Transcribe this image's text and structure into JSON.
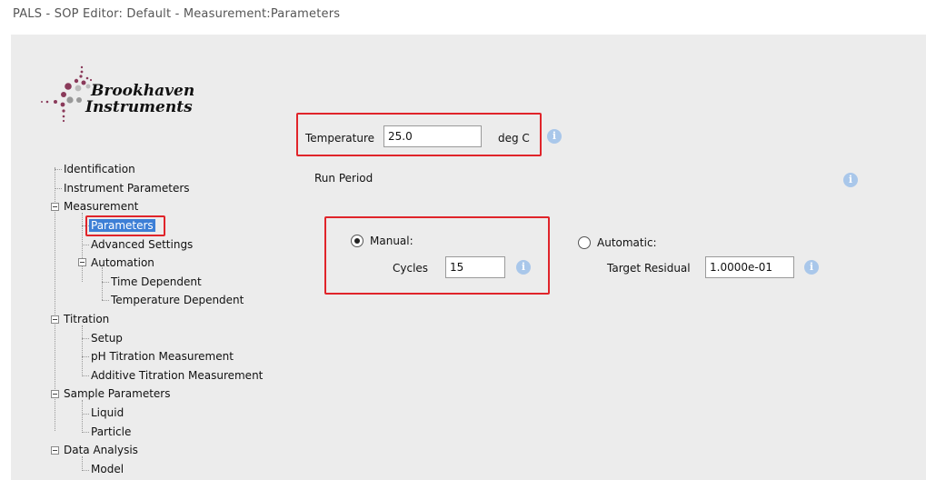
{
  "window": {
    "title": "PALS - SOP Editor: Default - Measurement:Parameters"
  },
  "logo": {
    "line1": "Brookhaven",
    "line2": "Instruments",
    "icon": "dots-logo-icon"
  },
  "tree": {
    "items": [
      {
        "label": "Identification"
      },
      {
        "label": "Instrument Parameters"
      },
      {
        "label": "Measurement"
      },
      {
        "label": "Parameters",
        "selected": true
      },
      {
        "label": "Advanced Settings"
      },
      {
        "label": "Automation"
      },
      {
        "label": "Time Dependent"
      },
      {
        "label": "Temperature Dependent"
      },
      {
        "label": "Titration"
      },
      {
        "label": "Setup"
      },
      {
        "label": "pH Titration Measurement"
      },
      {
        "label": "Additive Titration Measurement"
      },
      {
        "label": "Sample Parameters"
      },
      {
        "label": "Liquid"
      },
      {
        "label": "Particle"
      },
      {
        "label": "Data Analysis"
      },
      {
        "label": "Model"
      }
    ]
  },
  "form": {
    "temperature": {
      "label": "Temperature",
      "value": "25.0",
      "unit": "deg C"
    },
    "run_period": {
      "label": "Run Period"
    },
    "manual": {
      "label": "Manual:",
      "selected": true,
      "cycles_label": "Cycles",
      "cycles_value": "15"
    },
    "automatic": {
      "label": "Automatic:",
      "selected": false,
      "residual_label": "Target Residual",
      "residual_value": "1.0000e-01"
    },
    "info_glyph": "i"
  },
  "colors": {
    "highlight_box": "#e0242a",
    "selection": "#3d7fd6",
    "panel": "#ececec",
    "info_icon": "#a9c7ea"
  }
}
